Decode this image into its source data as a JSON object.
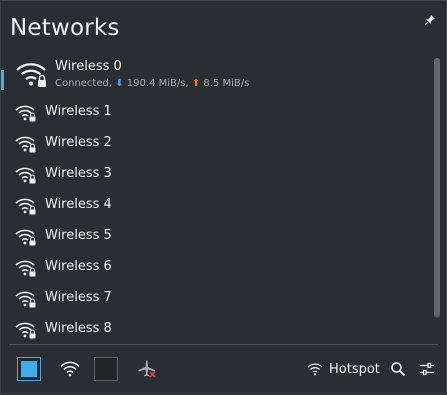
{
  "header": {
    "title": "Networks",
    "pin_icon": "pin-icon"
  },
  "connected": {
    "name": "Wireless 0",
    "status": "Connected,",
    "download": "190.4 MiB/s,",
    "upload": "8.5 MiB/s",
    "download_arrow": "⬇",
    "upload_arrow": "⬆"
  },
  "networks": [
    {
      "name": "Wireless 1"
    },
    {
      "name": "Wireless 2"
    },
    {
      "name": "Wireless 3"
    },
    {
      "name": "Wireless 4"
    },
    {
      "name": "Wireless 5"
    },
    {
      "name": "Wireless 6"
    },
    {
      "name": "Wireless 7"
    },
    {
      "name": "Wireless 8"
    }
  ],
  "footer": {
    "wifi_enabled": true,
    "mobile_enabled": false,
    "hotspot_label": "Hotspot"
  },
  "colors": {
    "accent": "#3daee9",
    "upload": "#f67400",
    "background": "#2a2e32",
    "text": "#eff0f1"
  }
}
